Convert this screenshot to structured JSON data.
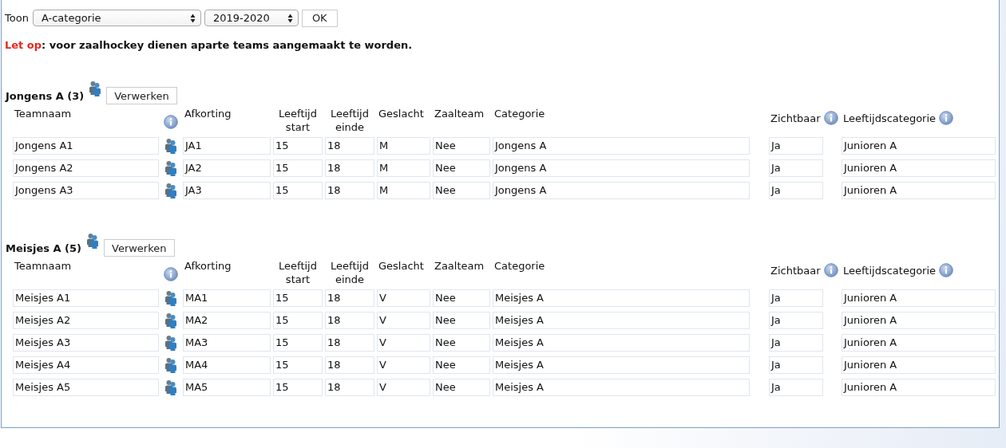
{
  "filter": {
    "label": "Toon",
    "category": "A-categorie",
    "season": "2019-2020",
    "ok": "OK"
  },
  "notice": {
    "label": "Let op",
    "text": ": voor zaalhockey dienen aparte teams aangemaakt te worden."
  },
  "groups": [
    {
      "title": "Jongens A (3)",
      "button": "Verwerken",
      "columns": [
        {
          "label": "Teamnaam",
          "info_icon": true
        },
        {
          "label": "Afkorting",
          "info_icon": false
        },
        {
          "label": "Leeftijd start",
          "info_icon": false
        },
        {
          "label": "Leeftijd einde",
          "info_icon": false
        },
        {
          "label": "Geslacht",
          "info_icon": false
        },
        {
          "label": "Zaalteam",
          "info_icon": false
        },
        {
          "label": "Categorie",
          "info_icon": false
        },
        {
          "label": "Zichtbaar",
          "info_icon": true
        },
        {
          "label": "Leeftijdscategorie",
          "info_icon": true
        }
      ],
      "rows": [
        [
          "Jongens A1",
          "JA1",
          "15",
          "18",
          "M",
          "Nee",
          "Jongens A",
          "Ja",
          "Junioren A"
        ],
        [
          "Jongens A2",
          "JA2",
          "15",
          "18",
          "M",
          "Nee",
          "Jongens A",
          "Ja",
          "Junioren A"
        ],
        [
          "Jongens A3",
          "JA3",
          "15",
          "18",
          "M",
          "Nee",
          "Jongens A",
          "Ja",
          "Junioren A"
        ]
      ]
    },
    {
      "title": "Meisjes A (5)",
      "button": "Verwerken",
      "columns": [
        {
          "label": "Teamnaam",
          "info_icon": true
        },
        {
          "label": "Afkorting",
          "info_icon": false
        },
        {
          "label": "Leeftijd start",
          "info_icon": false
        },
        {
          "label": "Leeftijd einde",
          "info_icon": false
        },
        {
          "label": "Geslacht",
          "info_icon": false
        },
        {
          "label": "Zaalteam",
          "info_icon": false
        },
        {
          "label": "Categorie",
          "info_icon": false
        },
        {
          "label": "Zichtbaar",
          "info_icon": true
        },
        {
          "label": "Leeftijdscategorie",
          "info_icon": true
        }
      ],
      "rows": [
        [
          "Meisjes A1",
          "MA1",
          "15",
          "18",
          "V",
          "Nee",
          "Meisjes A",
          "Ja",
          "Junioren A"
        ],
        [
          "Meisjes A2",
          "MA2",
          "15",
          "18",
          "V",
          "Nee",
          "Meisjes A",
          "Ja",
          "Junioren A"
        ],
        [
          "Meisjes A3",
          "MA3",
          "15",
          "18",
          "V",
          "Nee",
          "Meisjes A",
          "Ja",
          "Junioren A"
        ],
        [
          "Meisjes A4",
          "MA4",
          "15",
          "18",
          "V",
          "Nee",
          "Meisjes A",
          "Ja",
          "Junioren A"
        ],
        [
          "Meisjes A5",
          "MA5",
          "15",
          "18",
          "V",
          "Nee",
          "Meisjes A",
          "Ja",
          "Junioren A"
        ]
      ]
    }
  ]
}
